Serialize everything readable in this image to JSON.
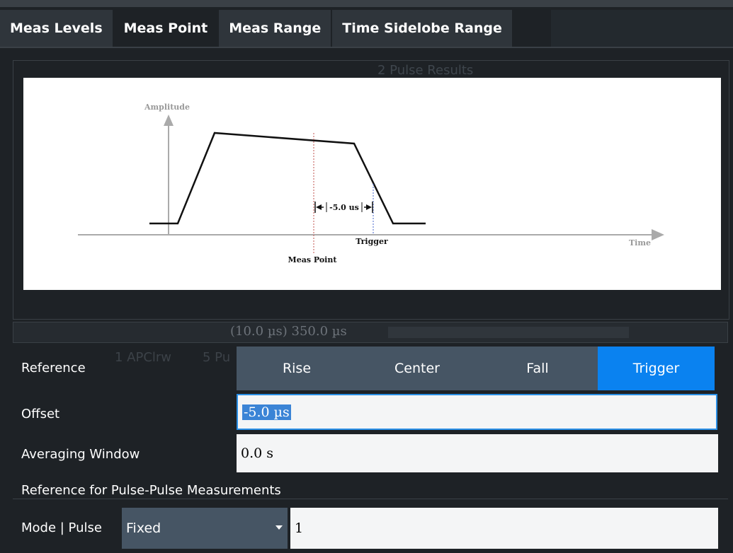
{
  "tabs": [
    {
      "label": "Meas Levels",
      "active": false
    },
    {
      "label": "Meas Point",
      "active": true
    },
    {
      "label": "Meas Range",
      "active": false
    },
    {
      "label": "Time Sidelobe Range",
      "active": false
    }
  ],
  "background": {
    "pulse_results": "2 Pulse Results",
    "time_span": "(10.0 µs) 350.0 µs",
    "trace_apclrw": "1 APClrw",
    "trace_pulse": "5 Pu"
  },
  "diagram": {
    "amplitude_label": "Amplitude",
    "time_label": "Time",
    "offset_label": "-5.0 us",
    "trigger_label": "Trigger",
    "meas_point_label": "Meas Point"
  },
  "reference": {
    "label": "Reference",
    "options": [
      "Rise",
      "Center",
      "Fall",
      "Trigger"
    ],
    "selected": "Trigger"
  },
  "offset": {
    "label": "Offset",
    "value": "-5.0 µs"
  },
  "averaging_window": {
    "label": "Averaging Window",
    "value": "0.0 s"
  },
  "pulse_pulse": {
    "section_title": "Reference for Pulse-Pulse Measurements",
    "mode_label": "Mode | Pulse",
    "mode_value": "Fixed",
    "pulse_value": "1"
  },
  "colors": {
    "accent": "#0a82f0",
    "segment": "#465564",
    "background": "#1e2226",
    "focus_border": "#2a8fe6"
  },
  "icons": {
    "dropdown": "chevron-down-icon",
    "offset_arrows": "dimension-arrows-icon",
    "axis_arrow": "arrow-head-icon"
  }
}
